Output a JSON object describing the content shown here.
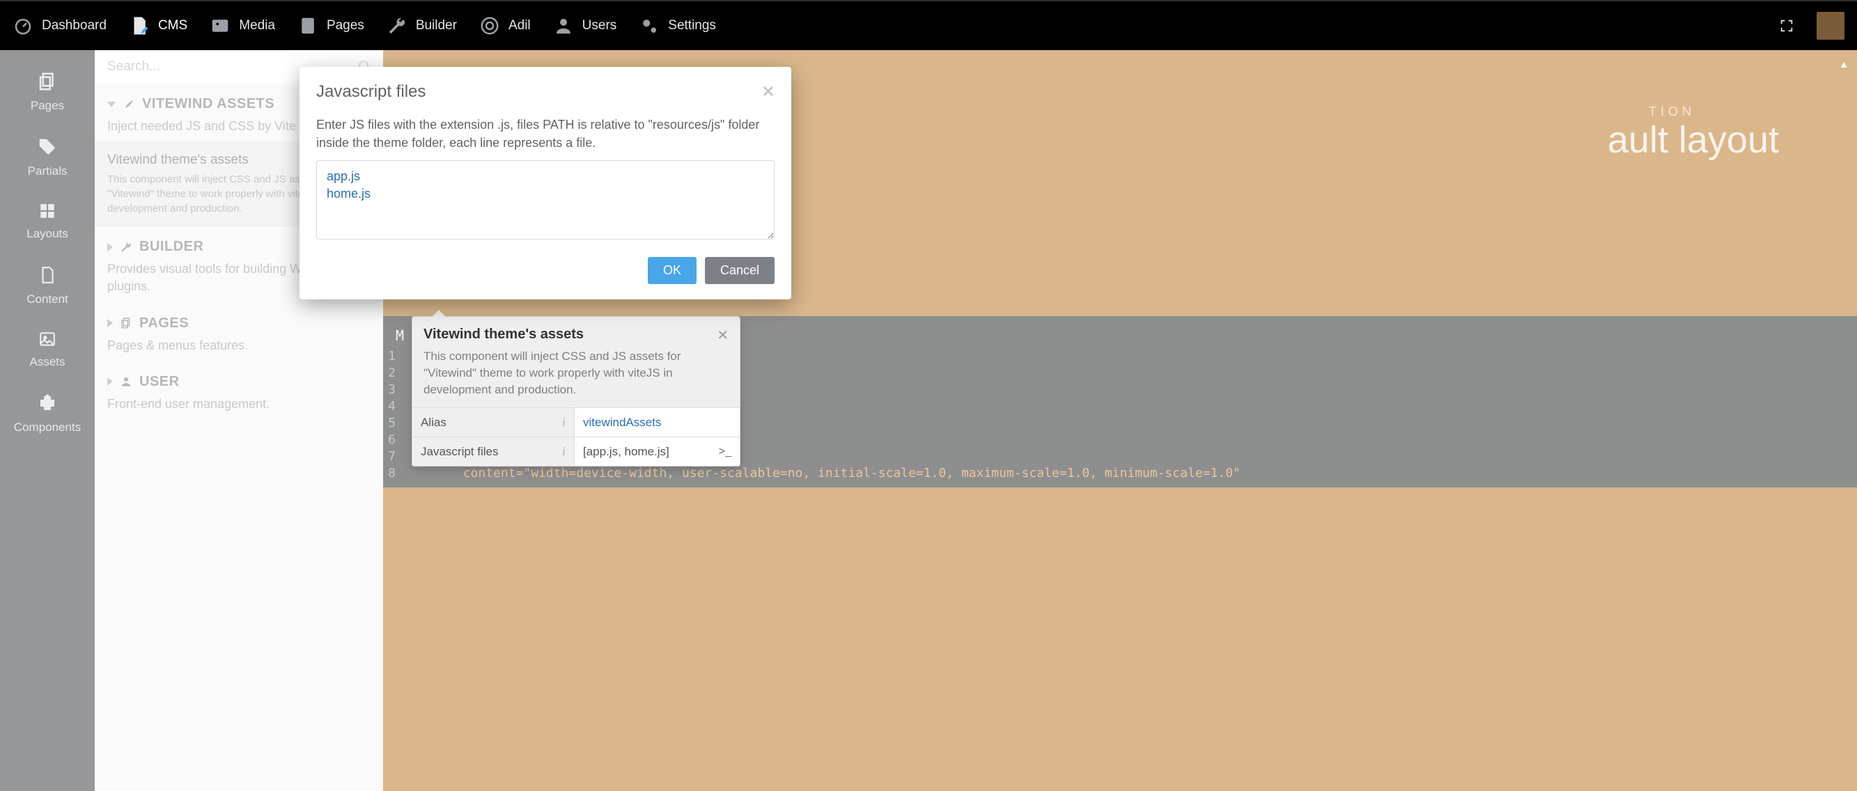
{
  "topnav": {
    "items": [
      {
        "label": "Dashboard",
        "icon": "gauge-icon"
      },
      {
        "label": "CMS",
        "icon": "file-edit-icon",
        "active": true
      },
      {
        "label": "Media",
        "icon": "image-icon"
      },
      {
        "label": "Pages",
        "icon": "checklist-icon"
      },
      {
        "label": "Builder",
        "icon": "wrench-icon"
      },
      {
        "label": "Adil",
        "icon": "life-ring-icon"
      },
      {
        "label": "Users",
        "icon": "user-icon"
      },
      {
        "label": "Settings",
        "icon": "gears-icon"
      }
    ]
  },
  "rail": {
    "items": [
      {
        "label": "Pages",
        "icon": "copy-icon"
      },
      {
        "label": "Partials",
        "icon": "tags-icon"
      },
      {
        "label": "Layouts",
        "icon": "grid-icon"
      },
      {
        "label": "Content",
        "icon": "file-icon"
      },
      {
        "label": "Assets",
        "icon": "picture-icon"
      },
      {
        "label": "Components",
        "icon": "puzzle-icon"
      }
    ]
  },
  "search": {
    "placeholder": "Search..."
  },
  "groups": [
    {
      "expanded": true,
      "icon": "rocket-icon",
      "title": "VITEWIND ASSETS",
      "desc": "Inject needed JS and CSS by Vite",
      "selected": {
        "title": "Vitewind theme's assets",
        "desc": "This component will inject CSS and JS assets for \"Vitewind\" theme to work properly with viteJS in development and production."
      }
    },
    {
      "expanded": false,
      "icon": "wrench-icon",
      "title": "BUILDER",
      "desc": "Provides visual tools for building Wintercms plugins."
    },
    {
      "expanded": false,
      "icon": "copy-icon",
      "title": "PAGES",
      "desc": "Pages & menus features."
    },
    {
      "expanded": false,
      "icon": "user-icon",
      "title": "USER",
      "desc": "Front-end user management."
    }
  ],
  "banner": {
    "eyebrow": "TION",
    "title": "ault layout"
  },
  "code": {
    "section": "M",
    "lines": [
      "1",
      "2",
      "3",
      "4",
      "5",
      "6",
      "7",
      "8"
    ],
    "visible_line": "content=\"width=device-width, user-scalable=no, initial-scale=1.0, maximum-scale=1.0, minimum-scale=1.0\""
  },
  "popover": {
    "title": "Vitewind theme's assets",
    "desc": "This component will inject CSS and JS assets for \"Vitewind\" theme to work properly with viteJS in development and production.",
    "rows": [
      {
        "label": "Alias",
        "value": "vitewindAssets",
        "expand": false
      },
      {
        "label": "Javascript files",
        "value": "[app.js, home.js]",
        "expand": true
      }
    ]
  },
  "modal": {
    "title": "Javascript files",
    "desc": "Enter JS files with the extension .js, files PATH is relative to \"resources/js\" folder inside the theme folder, each line represents a file.",
    "value": "app.js\nhome.js",
    "ok": "OK",
    "cancel": "Cancel"
  }
}
